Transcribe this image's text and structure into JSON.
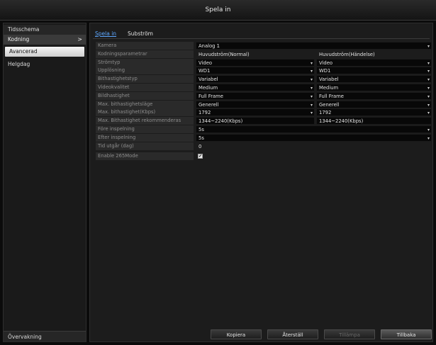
{
  "window": {
    "title": "Spela in"
  },
  "sidebar": {
    "items": [
      {
        "label": "Tidsschema",
        "type": "header"
      },
      {
        "label": "Kodning",
        "type": "sub",
        "chevron": ">"
      },
      {
        "label": "Avancerad",
        "type": "selected"
      },
      {
        "label": "Helgdag",
        "type": "plain"
      }
    ],
    "bottom": "Övervakning"
  },
  "tabs": [
    {
      "label": "Spela in",
      "active": true
    },
    {
      "label": "Subström",
      "active": false
    }
  ],
  "form": {
    "camera": {
      "label": "Kamera",
      "value": "Analog 1"
    },
    "params": {
      "label": "Kodningsparametrar",
      "main": "Huvudström(Normal)",
      "sub": "Huvudström(Händelse)"
    },
    "stream_type": {
      "label": "Strömtyp",
      "main": "Video",
      "sub": "Video"
    },
    "resolution": {
      "label": "Upplösning",
      "main": "WD1",
      "sub": "WD1"
    },
    "bitrate_type": {
      "label": "Bithastighetstyp",
      "main": "Variabel",
      "sub": "Variabel"
    },
    "video_quality": {
      "label": "Videokvalitet",
      "main": "Medium",
      "sub": "Medium"
    },
    "frame_rate": {
      "label": "Bildhastighet",
      "main": "Full Frame",
      "sub": "Full Frame"
    },
    "max_bitrate_mode": {
      "label": "Max. bithastighetsläge",
      "main": "Generell",
      "sub": "Generell"
    },
    "max_bitrate": {
      "label": "Max. bithastighet(Kbps)",
      "main": "1792",
      "sub": "1792"
    },
    "max_bitrate_range": {
      "label": "Max. Bithastighet rekommenderas",
      "main": "1344~2240(Kbps)",
      "sub": "1344~2240(Kbps)"
    },
    "pre_record": {
      "label": "Före inspelning",
      "value": "5s"
    },
    "post_record": {
      "label": "Efter inspelning",
      "value": "5s"
    },
    "expire_days": {
      "label": "Tid utgår (dag)",
      "value": "0"
    },
    "h264plus": {
      "label": "Enable 265Mode",
      "checked": true
    }
  },
  "buttons": {
    "copy": "Kopiera",
    "restore": "Återställ",
    "apply": "Tillämpa",
    "back": "Tillbaka"
  },
  "icons": {
    "dropdown": "dropdown-arrow-icon",
    "check": "checkmark-icon",
    "chevron": "chevron-right-icon"
  },
  "colors": {
    "accent": "#5ea8ff",
    "background": "#1c1c1c",
    "field": "#080808"
  }
}
